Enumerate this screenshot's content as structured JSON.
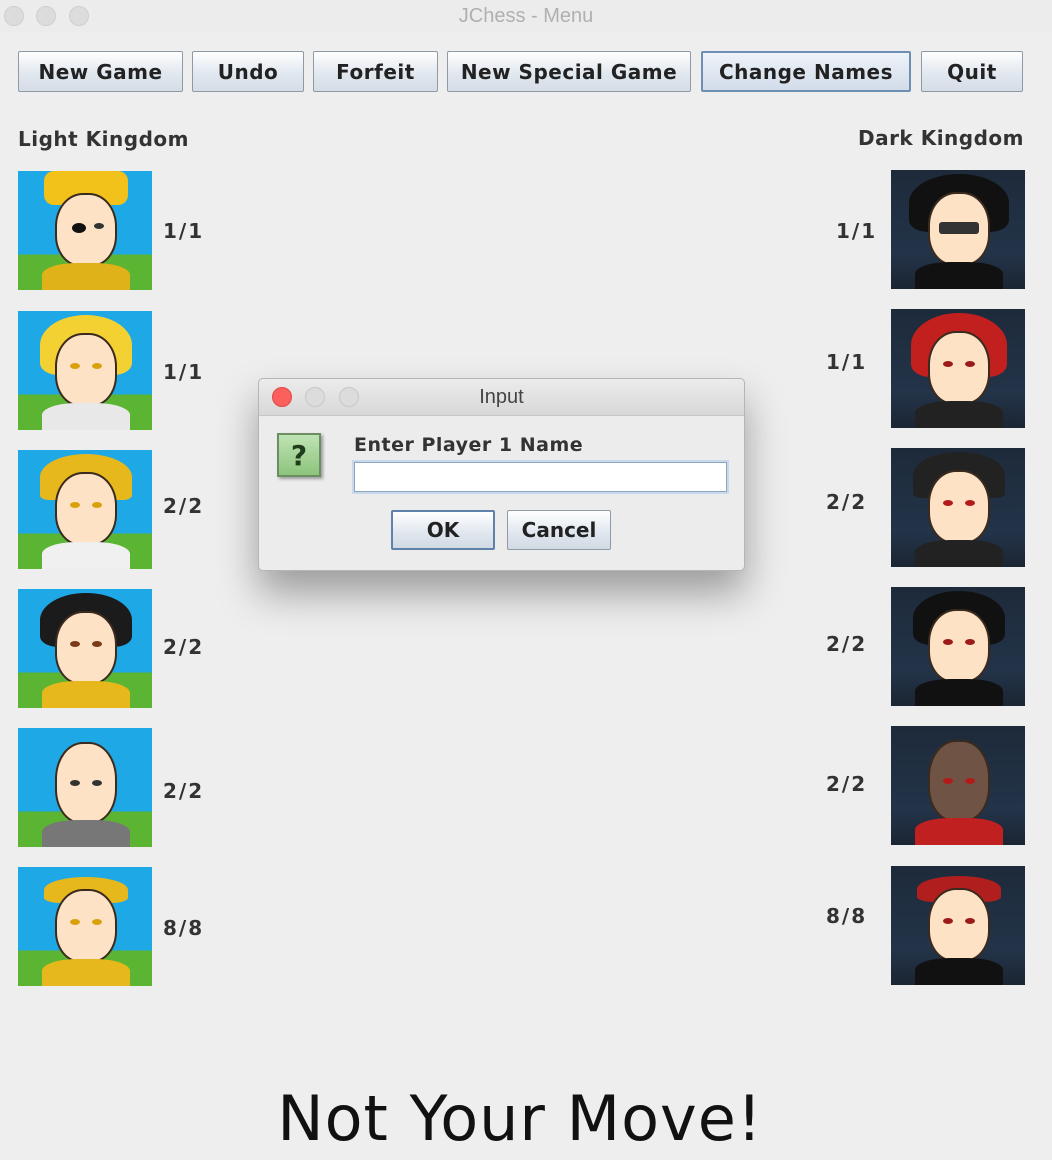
{
  "window": {
    "title": "JChess - Menu"
  },
  "toolbar": {
    "new_game": "New Game",
    "undo": "Undo",
    "forfeit": "Forfeit",
    "new_special_game": "New Special Game",
    "change_names": "Change Names",
    "quit": "Quit"
  },
  "light": {
    "title": "Light Kingdom",
    "pieces": [
      {
        "piece": "king",
        "count": "1/1"
      },
      {
        "piece": "queen",
        "count": "1/1"
      },
      {
        "piece": "rook",
        "count": "2/2"
      },
      {
        "piece": "knight",
        "count": "2/2"
      },
      {
        "piece": "bishop",
        "count": "2/2"
      },
      {
        "piece": "pawn",
        "count": "8/8"
      }
    ]
  },
  "dark": {
    "title": "Dark Kingdom",
    "pieces": [
      {
        "piece": "king",
        "count": "1/1"
      },
      {
        "piece": "queen",
        "count": "1/1"
      },
      {
        "piece": "rook",
        "count": "2/2"
      },
      {
        "piece": "knight",
        "count": "2/2"
      },
      {
        "piece": "bishop",
        "count": "2/2"
      },
      {
        "piece": "pawn",
        "count": "8/8"
      }
    ]
  },
  "dialog": {
    "title": "Input",
    "prompt": "Enter Player 1 Name",
    "input_value": "",
    "ok_label": "OK",
    "cancel_label": "Cancel",
    "icon": "question-icon",
    "icon_glyph": "?"
  },
  "status": "Not Your Move!",
  "colors": {
    "light_sky": "#1fa8e6",
    "light_grass": "#5bb533",
    "dark_bg": "#1d2a3a",
    "close_red": "#fc605c"
  }
}
